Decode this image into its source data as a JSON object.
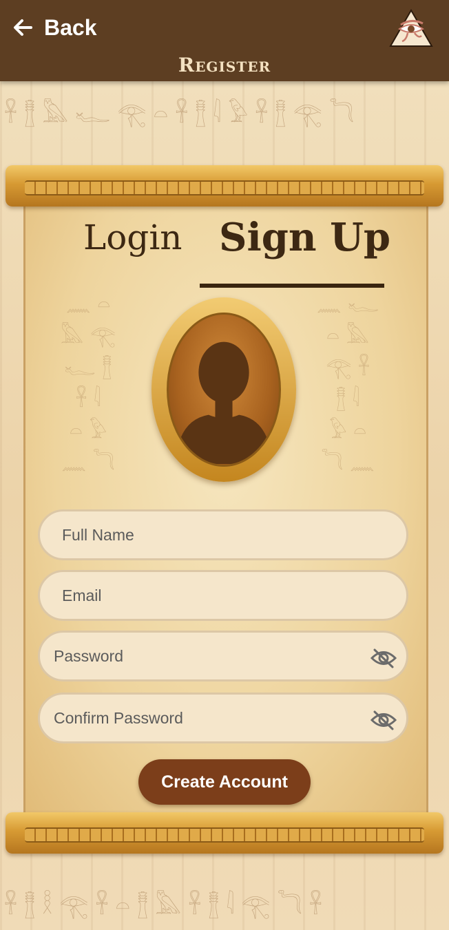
{
  "header": {
    "back_label": "Back",
    "title": "Register",
    "logo_icon": "eye-of-horus-icon",
    "background_color": "#5d3e22"
  },
  "tabs": {
    "login_label": "Login",
    "signup_label": "Sign Up",
    "active": "Sign Up"
  },
  "avatar": {
    "icon": "person-silhouette-icon"
  },
  "form": {
    "full_name_placeholder": "Full Name",
    "email_placeholder": "Email",
    "password_placeholder": "Password",
    "confirm_password_placeholder": "Confirm Password",
    "visibility_icon": "eye-off-icon",
    "submit_label": "Create Account"
  },
  "colors": {
    "button": "#7c3e1a",
    "paper": "#eed49d",
    "gold": "#d79a33"
  }
}
